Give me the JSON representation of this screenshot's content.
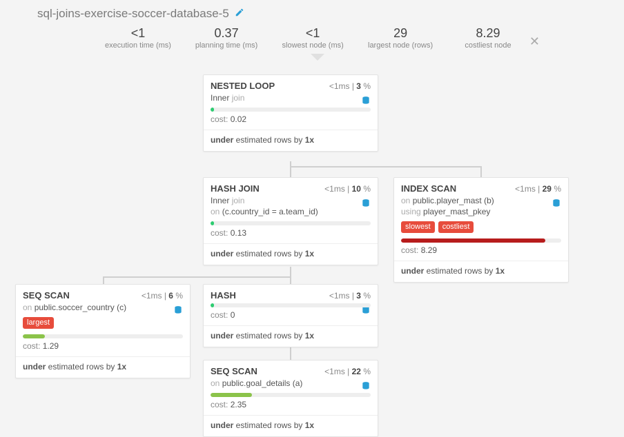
{
  "title": "sql-joins-exercise-soccer-database-5",
  "metrics": {
    "exec_val": "<1",
    "exec_lab": "execution time (ms)",
    "plan_val": "0.37",
    "plan_lab": "planning time (ms)",
    "slow_val": "<1",
    "slow_lab": "slowest node (ms)",
    "large_val": "29",
    "large_lab": "largest node (rows)",
    "cost_val": "8.29",
    "cost_lab": "costliest node"
  },
  "labels": {
    "cost_prefix": "cost: ",
    "est_under": "under",
    "est_mid": " estimated rows by ",
    "est_factor": "1x",
    "ms_suffix": "ms",
    "pct_suffix": " %",
    "sep": " | "
  },
  "nodes": {
    "n1": {
      "name": "NESTED LOOP",
      "time": "<1",
      "pct": "3",
      "sub_html": "Inner <span class='dim'>join</span>",
      "bar_color": "#2ecc71",
      "bar_width": "2%",
      "cost": "0.02"
    },
    "n2": {
      "name": "HASH JOIN",
      "time": "<1",
      "pct": "10",
      "sub_html": "Inner <span class='dim'>join</span><br><span class='dim'>on</span> (c.country_id = a.team_id)",
      "bar_color": "#2ecc71",
      "bar_width": "2%",
      "cost": "0.13"
    },
    "n3": {
      "name": "INDEX SCAN",
      "time": "<1",
      "pct": "29",
      "sub_html": "<span class='dim'>on</span> public.player_mast (b)<br><span class='dim'>using</span> player_mast_pkey",
      "badges": [
        "slowest",
        "costliest"
      ],
      "bar_color": "#b71c1c",
      "bar_width": "90%",
      "cost": "8.29"
    },
    "n4": {
      "name": "SEQ SCAN",
      "time": "<1",
      "pct": "6",
      "sub_html": "<span class='dim'>on</span> public.soccer_country (c)",
      "badges": [
        "largest"
      ],
      "bar_color": "#8bc34a",
      "bar_width": "14%",
      "cost": "1.29"
    },
    "n5": {
      "name": "HASH",
      "time": "<1",
      "pct": "3",
      "bar_color": "#2ecc71",
      "bar_width": "2%",
      "cost": "0"
    },
    "n6": {
      "name": "SEQ SCAN",
      "time": "<1",
      "pct": "22",
      "sub_html": "<span class='dim'>on</span> public.goal_details (a)",
      "bar_color": "#8bc34a",
      "bar_width": "26%",
      "cost": "2.35"
    }
  }
}
